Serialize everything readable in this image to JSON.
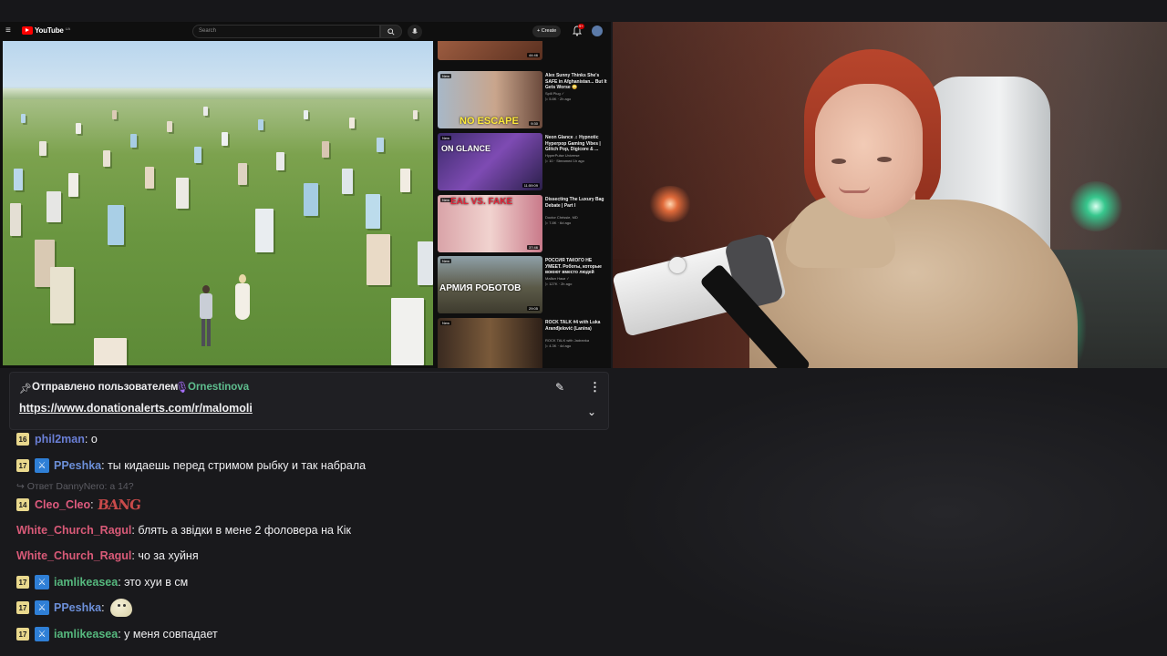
{
  "youtube": {
    "logo_text": "YouTube",
    "logo_region": "UA",
    "search_placeholder": "Search",
    "create_label": "+ Create",
    "notifications_badge": "9+",
    "recommendations": [
      {
        "title": "",
        "channel": "",
        "stats": "",
        "duration": "44:46",
        "new": ""
      },
      {
        "title": "Alex Sunny Thinks She's SAFE in Afghanistan... But It Gets Worse 😳",
        "channel": "Spill Plug ✓",
        "stats": "▷ 5.8K · 2h ago",
        "duration": "9:30",
        "new": "New",
        "overlay": "NO ESCAPE"
      },
      {
        "title": "Neon Glance ♫ Hypnotic Hyperpop Gaming Vibes | Glitch Pop, Digicore & ...",
        "channel": "HyperPulse Universe",
        "stats": "▷ 10 · Streamed 1h ago",
        "duration": "11:59:09",
        "new": "New",
        "overlay": "ON GLANCE"
      },
      {
        "title": "Dissecting The Luxury Bag Debate | Part I",
        "channel": "Doctor Chrissie, MD",
        "stats": "▷ 7.8K · 6d ago",
        "duration": "37:46",
        "new": "New",
        "overlay": "EAL VS. FAKE"
      },
      {
        "title": "РОССИЯ ТАКОГО НЕ УМЕЕТ. Роботы, которые воюют вместо людей",
        "channel": "Майкл Наки ✓",
        "stats": "▷ 127K · 2h ago",
        "duration": "29:05",
        "new": "New",
        "overlay": "АРМИЯ РОБОТОВ"
      },
      {
        "title": "ROCK TALK #4 with Luka Aranđjelović (Lanina)",
        "channel": "ROCK TALK with Jadranka",
        "stats": "▷ 4.3K · 4d ago",
        "duration": "",
        "new": "New"
      }
    ]
  },
  "pinned": {
    "label": "Отправлено пользователем",
    "user": "Ornestinova",
    "link": "https://www.donationalerts.com/r/malomoli"
  },
  "chat": {
    "reply_hint": "↪ Ответ DannyNero: а 14?",
    "messages": [
      {
        "badge": "16",
        "mod": false,
        "user": "phil2man",
        "color": "#6a7fd6",
        "text": ": о"
      },
      {
        "badge": "17",
        "mod": true,
        "user": "PPeshka",
        "color": "#6c8fd8",
        "text": ": ты кидаешь перед стримом рыбку и так набрала"
      },
      {
        "badge": "14",
        "mod": false,
        "user": "Cleo_Cleo",
        "color": "#e05b7f",
        "text": ":",
        "emote": "BANG"
      },
      {
        "badge": "",
        "mod": false,
        "user": "White_Church_Ragul",
        "color": "#d95a78",
        "text": ": блять а звідки в мене 2 фоловера на Кік"
      },
      {
        "badge": "",
        "mod": false,
        "user": "White_Church_Ragul",
        "color": "#d95a78",
        "text": ": чо за хуйня"
      },
      {
        "badge": "17",
        "mod": true,
        "user": "iamlikeasea",
        "color": "#56b87e",
        "text": ": это хуи в см"
      },
      {
        "badge": "17",
        "mod": true,
        "user": "PPeshka",
        "color": "#6c8fd8",
        "text": ":",
        "emote": "blob"
      },
      {
        "badge": "17",
        "mod": true,
        "user": "iamlikeasea",
        "color": "#56b87e",
        "text": ": у меня совпадает"
      }
    ]
  }
}
